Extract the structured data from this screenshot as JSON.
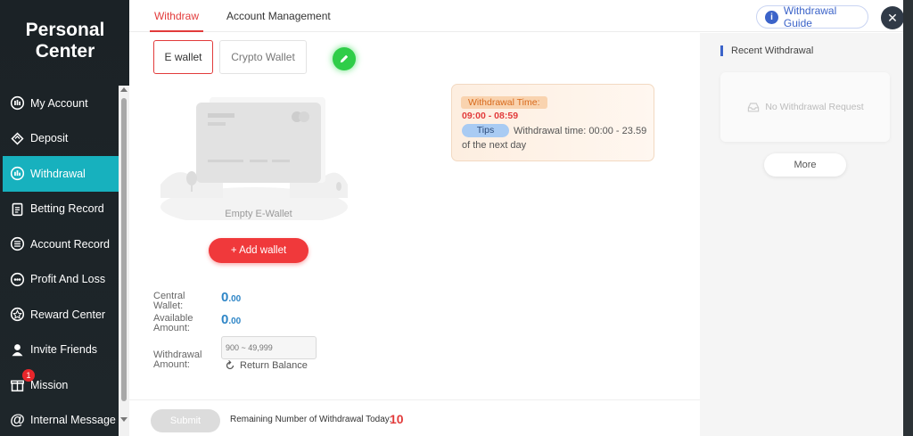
{
  "sidebar": {
    "title_line1": "Personal",
    "title_line2": "Center",
    "items": [
      {
        "label": "My Account",
        "icon": "account-icon"
      },
      {
        "label": "Deposit",
        "icon": "deposit-icon"
      },
      {
        "label": "Withdrawal",
        "icon": "withdrawal-icon",
        "active": true
      },
      {
        "label": "Betting Record",
        "icon": "clipboard-icon"
      },
      {
        "label": "Account Record",
        "icon": "list-icon"
      },
      {
        "label": "Profit And Loss",
        "icon": "profit-icon"
      },
      {
        "label": "Reward Center",
        "icon": "reward-icon"
      },
      {
        "label": "Invite Friends",
        "icon": "person-icon"
      },
      {
        "label": "Mission",
        "icon": "gift-icon",
        "badge": "1"
      },
      {
        "label": "Internal Message",
        "icon": "at-icon"
      }
    ]
  },
  "header": {
    "tabs": [
      {
        "label": "Withdraw",
        "active": true
      },
      {
        "label": "Account Management"
      }
    ],
    "guide_label": "Withdrawal Guide",
    "close_icon": "close-icon"
  },
  "wallet_tabs": {
    "e_wallet": "E wallet",
    "crypto_wallet": "Crypto Wallet",
    "edit_icon": "pencil-icon"
  },
  "empty_wallet": {
    "text": "Empty E-Wallet",
    "add_label": "+ Add wallet"
  },
  "withdrawal_time": {
    "label": "Withdrawal Time:",
    "time": "09:00  - 08:59",
    "tips_label": "Tips",
    "tips_text": "Withdrawal time: 00:00 - 23.59 of the next day"
  },
  "form": {
    "central_wallet_label": "Central Wallet:",
    "central_wallet_int": "0",
    "central_wallet_dec": ".00",
    "available_label": "Available Amount:",
    "available_int": "0",
    "available_dec": ".00",
    "withdrawal_amount_label": "Withdrawal Amount:",
    "amount_placeholder": "900 ~ 49,999",
    "return_balance": "Return Balance"
  },
  "footer": {
    "submit_label": "Submit",
    "remaining_label": "Remaining Number of Withdrawal Today:",
    "remaining_count": "10"
  },
  "recent": {
    "title": "Recent Withdrawal",
    "empty_text": "No Withdrawal Request",
    "more_label": "More"
  },
  "colors": {
    "accent_red": "#e23b3b",
    "active_teal": "#17b1be",
    "blue": "#3b63c9",
    "green": "#2fcd48"
  }
}
